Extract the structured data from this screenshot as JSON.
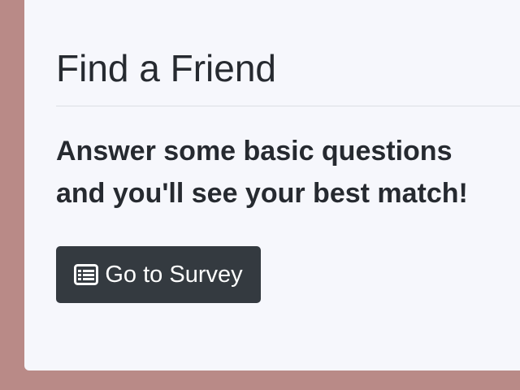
{
  "card": {
    "title": "Find a Friend",
    "lead_line1": "Answer some basic questions",
    "lead_line2": "and you'll see your best match!"
  },
  "survey_button": {
    "label": "Go to Survey",
    "icon": "list-alt-icon"
  },
  "colors": {
    "page_background": "#b98a87",
    "card_background": "#f6f7fc",
    "text": "#262a30",
    "button_background": "#343a40",
    "button_text": "#ffffff"
  }
}
